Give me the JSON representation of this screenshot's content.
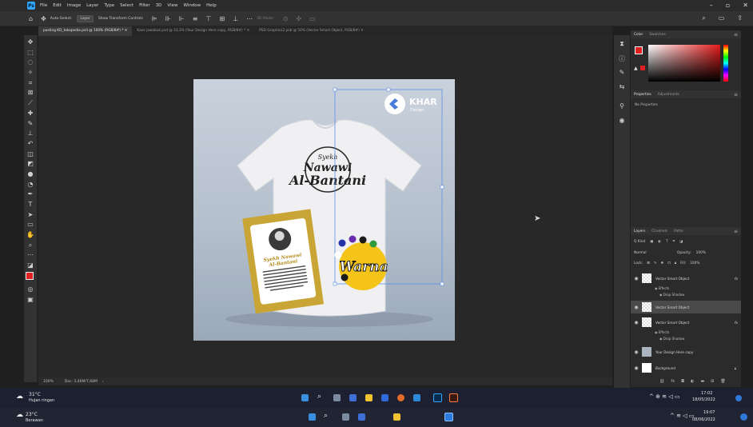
{
  "menubar": {
    "items": [
      "File",
      "Edit",
      "Image",
      "Layer",
      "Type",
      "Select",
      "Filter",
      "3D",
      "View",
      "Window",
      "Help"
    ]
  },
  "options": {
    "auto_select": "Auto-Select:",
    "layer": "Layer",
    "show_transform": "Show Transform Controls",
    "mode_3d": "3D Mode:"
  },
  "tabs": [
    "posting KD_tokopedia.psd @ 100% (RGB/8#) *",
    "Kaos jawabuk.psd @ 33,3% (Your Design Here copy, RGB/8#) *",
    "PSD-Graphics2.psb @ 50% (Vector Smart Object, RGB/8#)"
  ],
  "status": {
    "zoom": "100%",
    "doc": "Doc: 3,46M/7,68M"
  },
  "artwork": {
    "brand_name": "KHAR",
    "brand_sub": "Design",
    "shirt_line1": "Syekh",
    "shirt_line2": "Nawawi",
    "shirt_line3": "Al-Bantani",
    "card_title_line1": "Syekh Nawawi",
    "card_title_line2": "Al-Bantani",
    "badge_text": "Warna"
  },
  "color_panel": {
    "tab_color": "Color",
    "tab_swatches": "Swatches",
    "fg_color": "#e02020"
  },
  "properties_panel": {
    "tab_properties": "Properties",
    "tab_adjustments": "Adjustments",
    "empty": "No Properties"
  },
  "layers_panel": {
    "tab_layers": "Layers",
    "tab_channels": "Channels",
    "tab_paths": "Paths",
    "kind": "Q Kind",
    "blend": "Normal",
    "opacity_label": "Opacity:",
    "opacity": "100%",
    "lock_label": "Lock:",
    "fill_label": "Fill:",
    "fill": "100%",
    "layers": [
      {
        "name": "Vector Smart Object",
        "effects": "Effects",
        "shadow": "Drop Shadow"
      },
      {
        "name": "Vector Smart Object"
      },
      {
        "name": "Vector Smart Object",
        "effects": "Effects",
        "shadow": "Drop Shadow"
      },
      {
        "name": "Your Design Here copy"
      },
      {
        "name": "Background"
      }
    ]
  },
  "taskbar_top": {
    "temp": "31°C",
    "weather": "Hujan ringan",
    "time": "17:02",
    "date": "18/05/2022"
  },
  "taskbar_bottom": {
    "temp": "23°C",
    "weather": "Berawan",
    "time": "19:07",
    "date": "08/06/2022"
  }
}
